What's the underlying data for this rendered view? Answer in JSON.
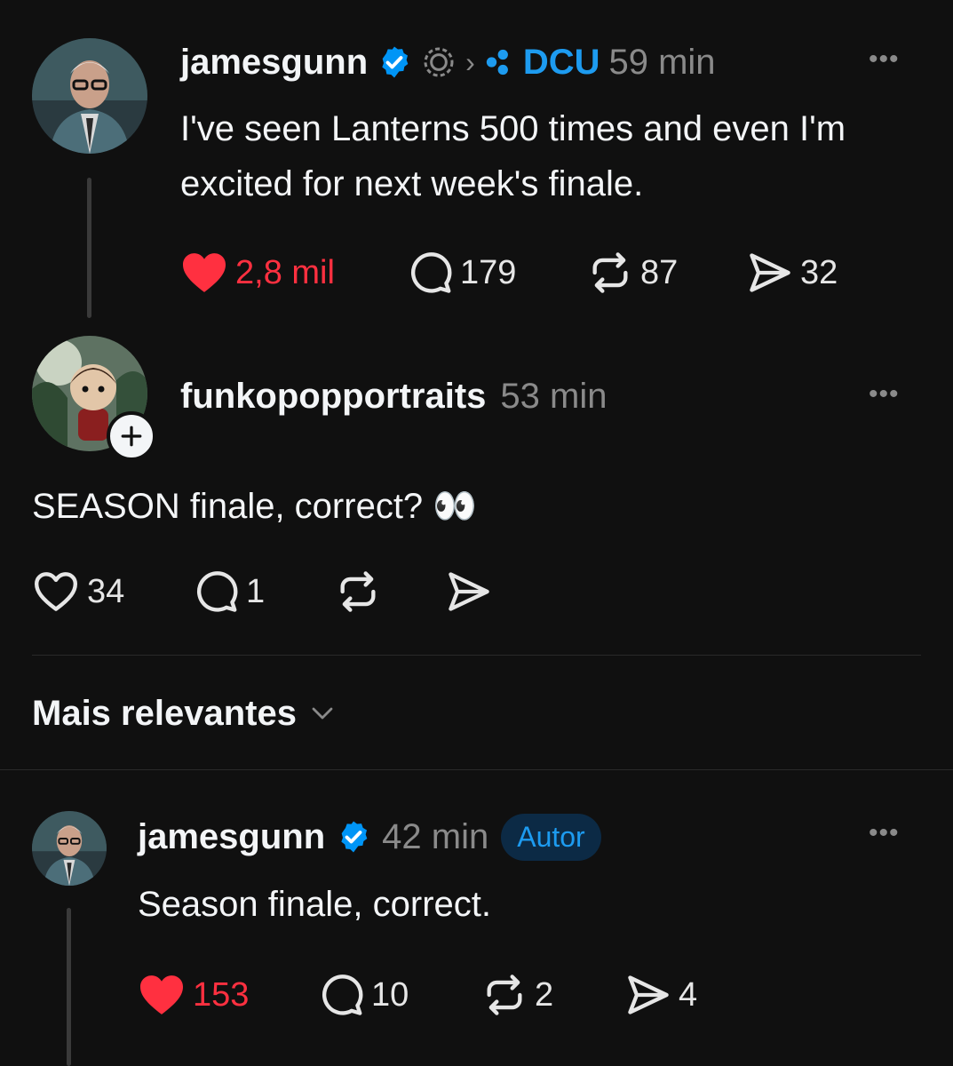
{
  "post": {
    "username": "jamesgunn",
    "community": "DCU",
    "time": "59 min",
    "text_line1": "I've seen Lanterns 500 times and even I'm",
    "text_line2": "excited for next week's finale.",
    "likes": "2,8 mil",
    "replies": "179",
    "reposts": "87",
    "shares": "32",
    "liked": true
  },
  "reply1": {
    "username": "funkopopportraits",
    "time": "53 min",
    "text": "SEASON finale, correct? 👀",
    "likes": "34",
    "replies": "1"
  },
  "sort": {
    "label": "Mais relevantes"
  },
  "reply2": {
    "username": "jamesgunn",
    "time": "42 min",
    "badge": "Autor",
    "text": "Season finale, correct.",
    "likes": "153",
    "replies": "10",
    "reposts": "2",
    "shares": "4",
    "liked": true
  },
  "colors": {
    "background": "#101010",
    "like_red": "#ff3040",
    "verified_blue": "#0095f6",
    "community_blue": "#1d9bf0",
    "author_badge_bg": "#0c2a45"
  }
}
